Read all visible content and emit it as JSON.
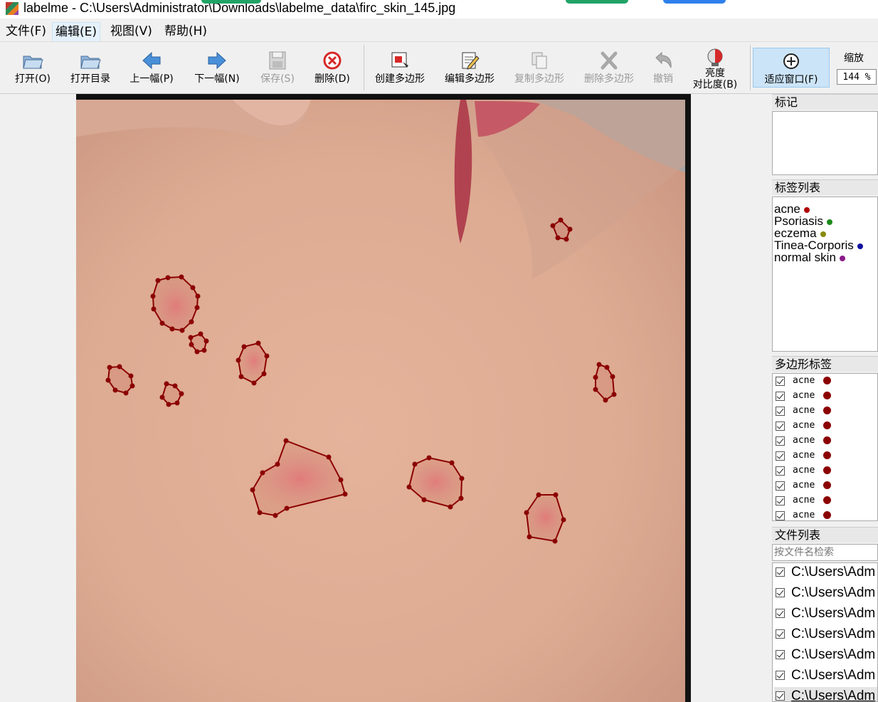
{
  "window": {
    "title": "labelme - C:\\Users\\Administrator\\Downloads\\labelme_data\\firc_skin_145.jpg"
  },
  "menu": [
    "文件(F)",
    "编辑(E)",
    "视图(V)",
    "帮助(H)"
  ],
  "toolbar": {
    "open": "打开(O)",
    "open_dir": "打开目录",
    "prev": "上一幅(P)",
    "next": "下一幅(N)",
    "save": "保存(S)",
    "delete": "删除(D)",
    "create_polygon": "创建多边形",
    "edit_polygon": "编辑多边形",
    "copy_polygon": "复制多边形",
    "delete_polygon": "删除多边形",
    "undo": "撤销",
    "brightness_line1": "亮度",
    "brightness_line2": "对比度(B)",
    "fit_window": "适应窗口(F)",
    "zoom_label": "缩放",
    "zoom_value": "144 %"
  },
  "panels": {
    "flags_title": "标记",
    "label_list_title": "标签列表",
    "labels": [
      {
        "name": "acne",
        "color": "#b00000"
      },
      {
        "name": "Psoriasis",
        "color": "#1a8a1a"
      },
      {
        "name": "eczema",
        "color": "#8a8a10"
      },
      {
        "name": "Tinea-Corporis",
        "color": "#1010a0"
      },
      {
        "name": "normal skin",
        "color": "#8a1a8a"
      }
    ],
    "polygon_labels_title": "多边形标签",
    "polygons": [
      "acne",
      "acne",
      "acne",
      "acne",
      "acne",
      "acne",
      "acne",
      "acne",
      "acne",
      "acne"
    ],
    "polygon_color": "#8b0000",
    "file_list_title": "文件列表",
    "file_search_placeholder": "按文件名检索",
    "files": [
      "C:\\Users\\Adm",
      "C:\\Users\\Adm",
      "C:\\Users\\Adm",
      "C:\\Users\\Adm",
      "C:\\Users\\Adm",
      "C:\\Users\\Adm",
      "C:\\Users\\Adm"
    ]
  }
}
